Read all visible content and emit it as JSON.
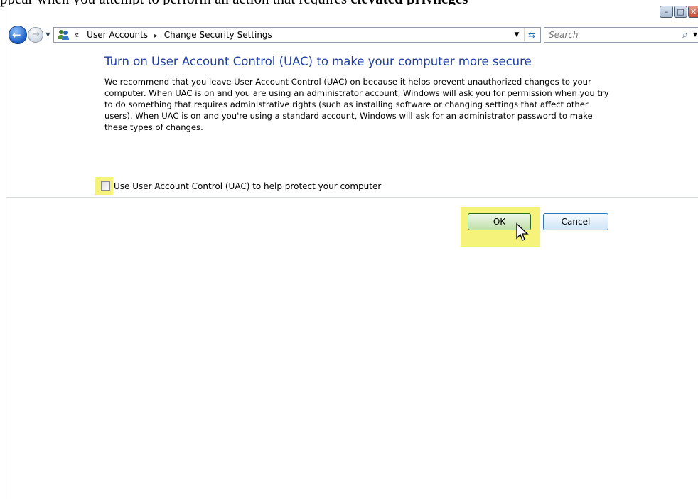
{
  "document_text": {
    "prefix": "ppear when you attempt to perform an action that requires ",
    "bold": "elevated privileges"
  },
  "window": {
    "controls": {
      "minimize_glyph": "–",
      "maximize_glyph": "□",
      "close_glyph": "✕"
    }
  },
  "navbar": {
    "back_glyph": "←",
    "forward_glyph": "→",
    "recent_drop_glyph": "▼",
    "breadcrumb": {
      "overflow": "«",
      "items": [
        "User Accounts",
        "Change Security Settings"
      ],
      "separator": "▸"
    },
    "address_drop_glyph": "▼",
    "refresh_glyph": "⇆",
    "search": {
      "placeholder": "Search",
      "search_glyph": "⌕",
      "drop_glyph": "▼"
    }
  },
  "main": {
    "heading": "Turn on User Account Control (UAC) to make your computer more secure",
    "description": "We recommend that you leave User Account Control (UAC) on because it helps prevent unauthorized changes to your computer.  When UAC is on and you are using an administrator account, Windows will ask you for permission when you try to do something that requires administrative rights (such as installing software or changing settings that affect other users).  When UAC is on and you're using a standard account, Windows will ask for an administrator password to make these types of changes.",
    "uac_checkbox": {
      "label": "Use User Account Control (UAC) to help protect your computer",
      "checked": false
    },
    "ok_label": "OK",
    "cancel_label": "Cancel"
  },
  "colors": {
    "heading": "#1e3fa6",
    "highlight": "#f6f37a",
    "ok_border": "#2c6b1e",
    "cancel_border": "#2f77b8"
  }
}
